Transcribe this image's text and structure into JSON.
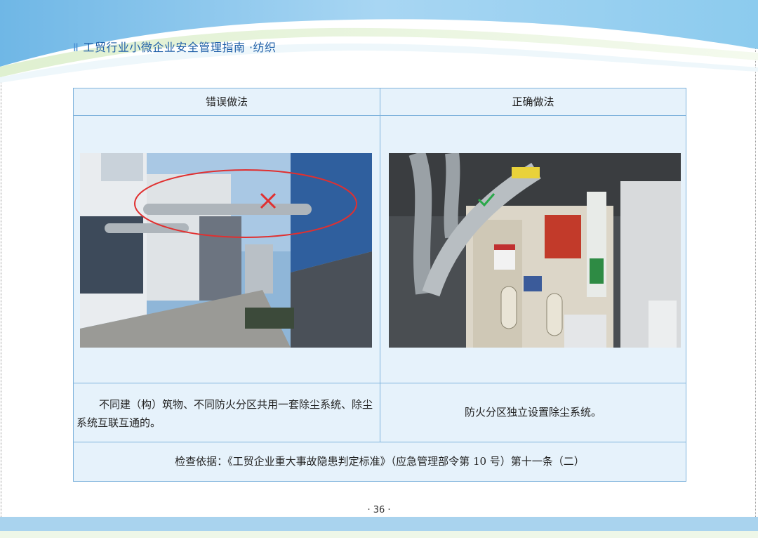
{
  "header": {
    "marker": "Ⅱ",
    "title": "工贸行业小微企业安全管理指南 ·纺织"
  },
  "table": {
    "wrong_heading": "错误做法",
    "right_heading": "正确做法",
    "wrong_description": "不同建（构）筑物、不同防火分区共用一套除尘系统、除尘系统互联互通的。",
    "right_description": "防火分区独立设置除尘系统。",
    "basis": "检查依据：《工贸企业重大事故隐患判定标准》（应急管理部令第 10 号）第十一条（二）"
  },
  "photos": {
    "wrong_photo_icon": "wrong-x-mark",
    "right_photo_icon": "right-check-mark",
    "accent_red": "#e03030",
    "accent_green": "#2aa84a"
  },
  "footer": {
    "page_number": "· 36 ·"
  }
}
